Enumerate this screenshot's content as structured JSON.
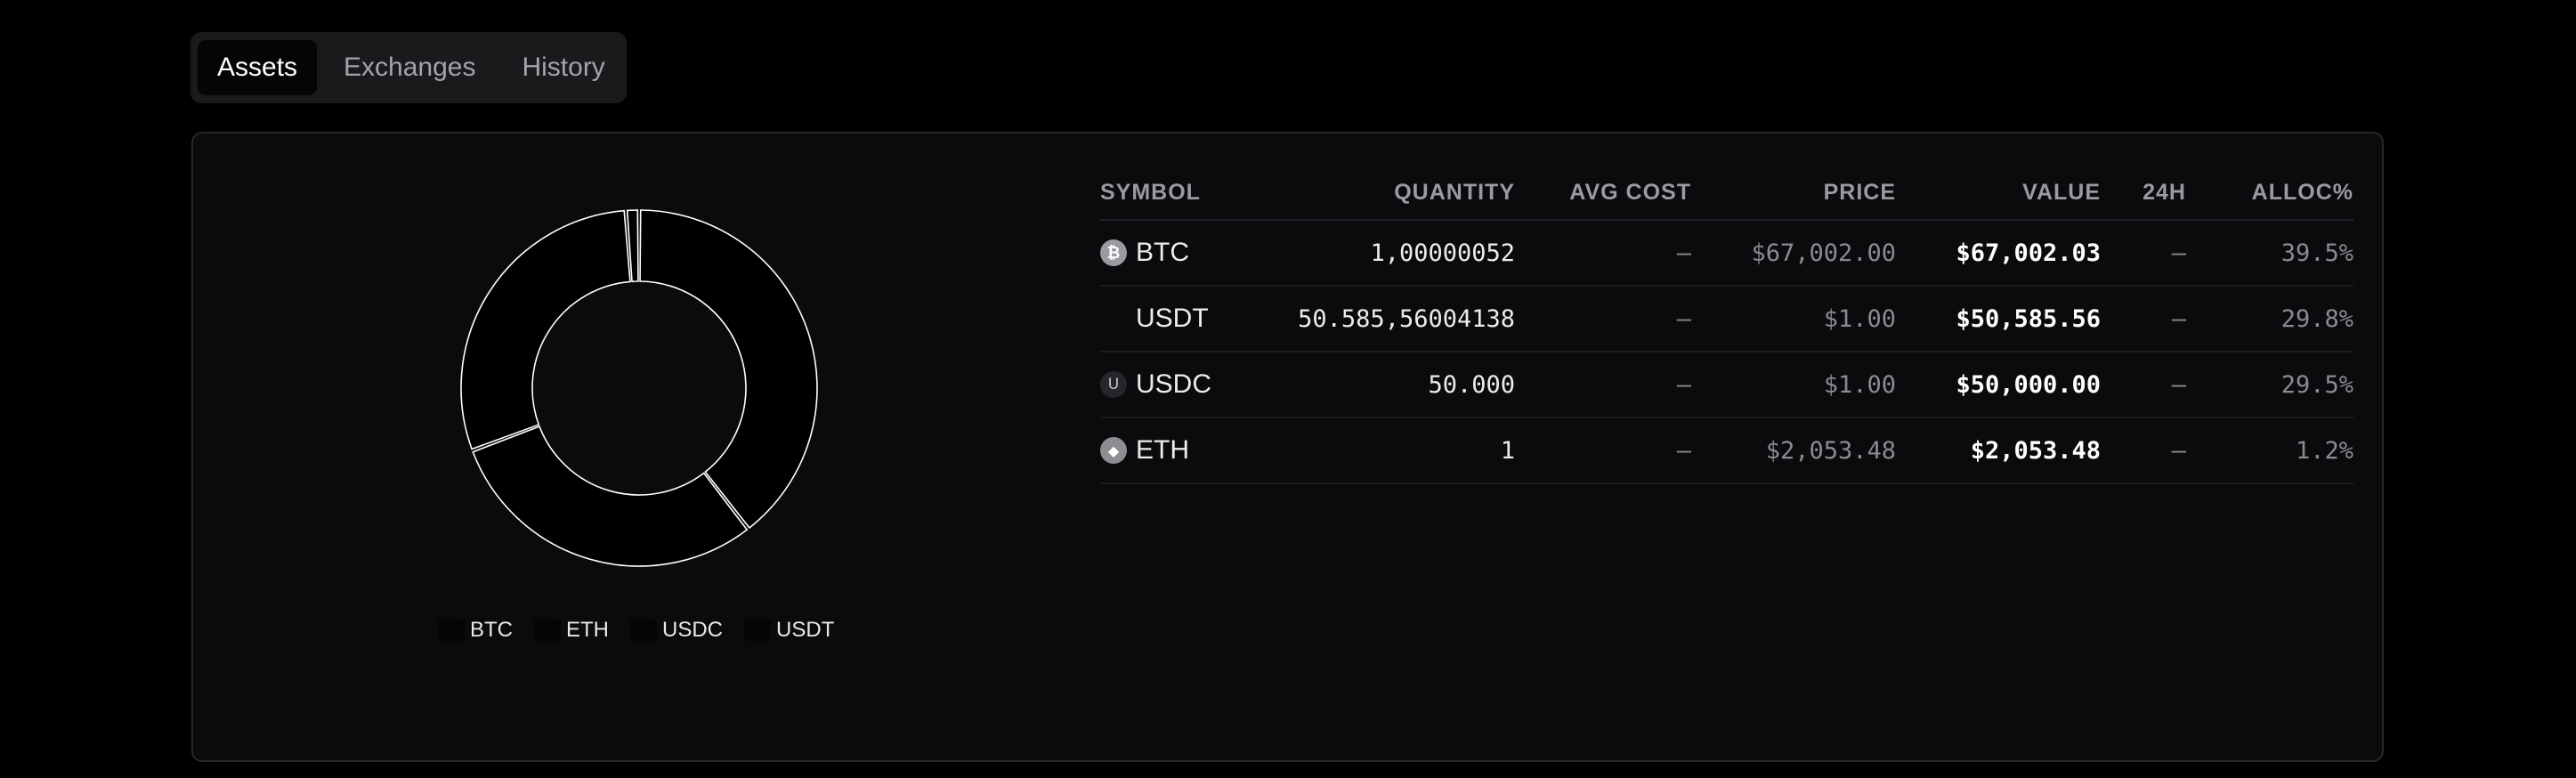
{
  "tabs": [
    {
      "label": "Assets",
      "active": true
    },
    {
      "label": "Exchanges",
      "active": false
    },
    {
      "label": "History",
      "active": false
    }
  ],
  "chart_data": {
    "type": "pie",
    "categories": [
      "BTC",
      "USDT",
      "USDC",
      "ETH"
    ],
    "values": [
      39.5,
      29.8,
      29.5,
      1.2
    ],
    "legend": [
      "BTC",
      "ETH",
      "USDC",
      "USDT"
    ],
    "legend_position": "bottom"
  },
  "table": {
    "headers": {
      "symbol": "SYMBOL",
      "quantity": "QUANTITY",
      "avg_cost": "AVG COST",
      "price": "PRICE",
      "value": "VALUE",
      "change_24h": "24H",
      "alloc": "ALLOC%"
    },
    "rows": [
      {
        "icon": "bitcoin-icon",
        "symbol": "BTC",
        "quantity": "1,00000052",
        "avg_cost": "—",
        "price": "$67,002.00",
        "value": "$67,002.03",
        "change_24h": "—",
        "alloc": "39.5%"
      },
      {
        "icon": "",
        "symbol": "USDT",
        "quantity": "50.585,56004138",
        "avg_cost": "—",
        "price": "$1.00",
        "value": "$50,585.56",
        "change_24h": "—",
        "alloc": "29.8%"
      },
      {
        "icon": "usdc-icon",
        "symbol": "USDC",
        "quantity": "50.000",
        "avg_cost": "—",
        "price": "$1.00",
        "value": "$50,000.00",
        "change_24h": "—",
        "alloc": "29.5%"
      },
      {
        "icon": "ethereum-icon",
        "symbol": "ETH",
        "quantity": "1",
        "avg_cost": "—",
        "price": "$2,053.48",
        "value": "$2,053.48",
        "change_24h": "—",
        "alloc": "1.2%"
      }
    ]
  },
  "colors": {
    "background": "#000000",
    "panel": "#0b0b0d",
    "panel_border": "#27272b",
    "tab_bar": "#1a1a1d",
    "slice_fill": "#000000",
    "slice_stroke": "#ffffff"
  }
}
